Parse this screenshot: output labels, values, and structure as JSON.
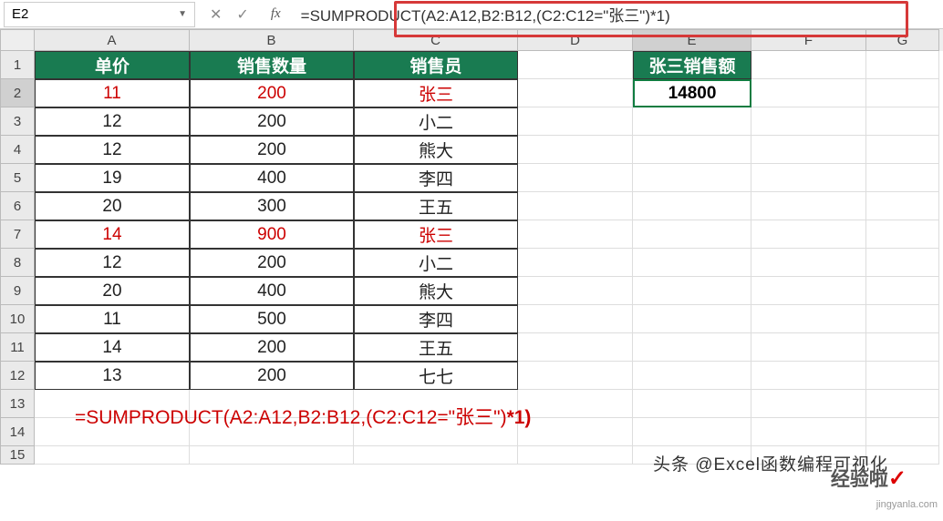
{
  "name_box": "E2",
  "formula_bar": "=SUMPRODUCT(A2:A12,B2:B12,(C2:C12=\"张三\")*1)",
  "columns": [
    "A",
    "B",
    "C",
    "D",
    "E",
    "F",
    "G"
  ],
  "headers": {
    "A": "单价",
    "B": "销售数量",
    "C": "销售员",
    "E": "张三销售额"
  },
  "rows": [
    {
      "A": "11",
      "B": "200",
      "C": "张三",
      "red": true
    },
    {
      "A": "12",
      "B": "200",
      "C": "小二"
    },
    {
      "A": "12",
      "B": "200",
      "C": "熊大"
    },
    {
      "A": "19",
      "B": "400",
      "C": "李四"
    },
    {
      "A": "20",
      "B": "300",
      "C": "王五"
    },
    {
      "A": "14",
      "B": "900",
      "C": "张三",
      "red": true
    },
    {
      "A": "12",
      "B": "200",
      "C": "小二"
    },
    {
      "A": "20",
      "B": "400",
      "C": "熊大"
    },
    {
      "A": "11",
      "B": "500",
      "C": "李四"
    },
    {
      "A": "14",
      "B": "200",
      "C": "王五"
    },
    {
      "A": "13",
      "B": "200",
      "C": "七七"
    }
  ],
  "result_value": "14800",
  "overlay_formula_prefix": "=SUMPRODUCT(A2:A12,B2:B12,(C2:C12=\"张三\")",
  "overlay_formula_bold": "*1)",
  "watermark1": "头条 @Excel函数编程可视化",
  "watermark2": "经验啦",
  "watermark3": "jingyanla.com",
  "chart_data": {
    "type": "table",
    "title": "张三销售额",
    "columns": [
      "单价",
      "销售数量",
      "销售员"
    ],
    "data": [
      [
        11,
        200,
        "张三"
      ],
      [
        12,
        200,
        "小二"
      ],
      [
        12,
        200,
        "熊大"
      ],
      [
        19,
        400,
        "李四"
      ],
      [
        20,
        300,
        "王五"
      ],
      [
        14,
        900,
        "张三"
      ],
      [
        12,
        200,
        "小二"
      ],
      [
        20,
        400,
        "熊大"
      ],
      [
        11,
        500,
        "李四"
      ],
      [
        14,
        200,
        "王五"
      ],
      [
        13,
        200,
        "七七"
      ]
    ],
    "result": {
      "label": "张三销售额",
      "value": 14800,
      "formula": "=SUMPRODUCT(A2:A12,B2:B12,(C2:C12=\"张三\")*1)"
    }
  }
}
